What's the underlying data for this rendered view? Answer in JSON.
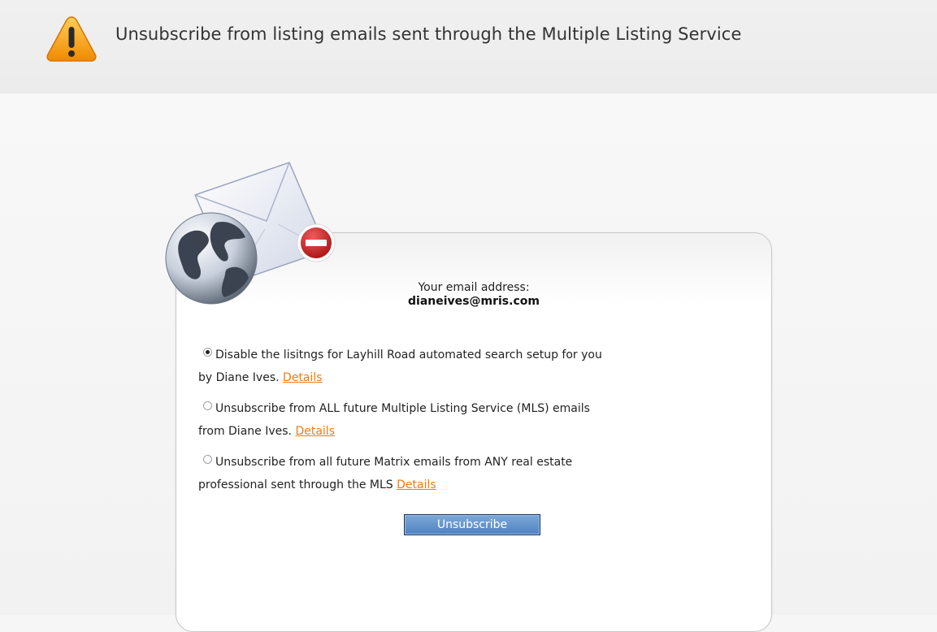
{
  "header": {
    "title": "Unsubscribe from listing emails sent through the Multiple Listing Service",
    "icon": "warning-icon"
  },
  "panel": {
    "email_label": "Your email address:",
    "email_value": "dianeives@mris.com",
    "graphic_icon": "email-globe-block-icon",
    "options": [
      {
        "checked": true,
        "line1": "Disable the lisitngs for Layhill Road automated search setup for you",
        "line2": "by Diane Ives.",
        "link": "Details"
      },
      {
        "checked": false,
        "line1": "Unsubscribe from ALL future Multiple Listing Service (MLS) emails",
        "line2": "from Diane Ives.",
        "link": "Details"
      },
      {
        "checked": false,
        "line1": "Unsubscribe from all future Matrix emails from ANY real estate",
        "line2": "professional sent through the MLS",
        "link": "Details"
      }
    ],
    "button_label": "Unsubscribe"
  },
  "colors": {
    "link": "#f07b12",
    "button_top": "#7da9d8",
    "button_bottom": "#4f82c1",
    "warning": "#f5a623"
  }
}
